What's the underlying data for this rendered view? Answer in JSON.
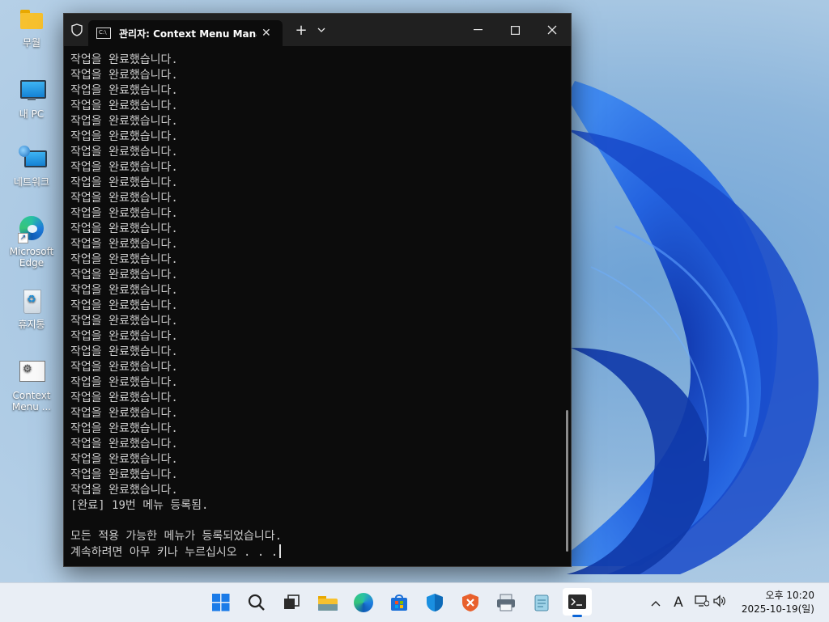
{
  "desktop": {
    "icons": [
      {
        "label": "무월"
      },
      {
        "label": "내 PC"
      },
      {
        "label": "네트워크"
      },
      {
        "label": "Microsoft Edge"
      },
      {
        "label": "휴지통"
      },
      {
        "label": "Context Menu ..."
      }
    ]
  },
  "terminal": {
    "tab_title": "관리자:  Context Menu Manag",
    "lines": [
      "작업을 완료했습니다.",
      "작업을 완료했습니다.",
      "작업을 완료했습니다.",
      "작업을 완료했습니다.",
      "작업을 완료했습니다.",
      "작업을 완료했습니다.",
      "작업을 완료했습니다.",
      "작업을 완료했습니다.",
      "작업을 완료했습니다.",
      "작업을 완료했습니다.",
      "작업을 완료했습니다.",
      "작업을 완료했습니다.",
      "작업을 완료했습니다.",
      "작업을 완료했습니다.",
      "작업을 완료했습니다.",
      "작업을 완료했습니다.",
      "작업을 완료했습니다.",
      "작업을 완료했습니다.",
      "작업을 완료했습니다.",
      "작업을 완료했습니다.",
      "작업을 완료했습니다.",
      "작업을 완료했습니다.",
      "작업을 완료했습니다.",
      "작업을 완료했습니다.",
      "작업을 완료했습니다.",
      "작업을 완료했습니다.",
      "작업을 완료했습니다.",
      "작업을 완료했습니다.",
      "작업을 완료했습니다.",
      "[완료] 19번 메뉴 등록됨.",
      "",
      "모든 적용 가능한 메뉴가 등록되었습니다.",
      "계속하려면 아무 키나 누르십시오 . . ."
    ],
    "new_tab": "+",
    "dropdown": "⌄",
    "minimize": "—",
    "maximize": "☐",
    "close": "✕"
  },
  "taskbar": {
    "tray_language": "A",
    "clock_time": "오후 10:20",
    "clock_date": "2025-10-19(일)"
  }
}
